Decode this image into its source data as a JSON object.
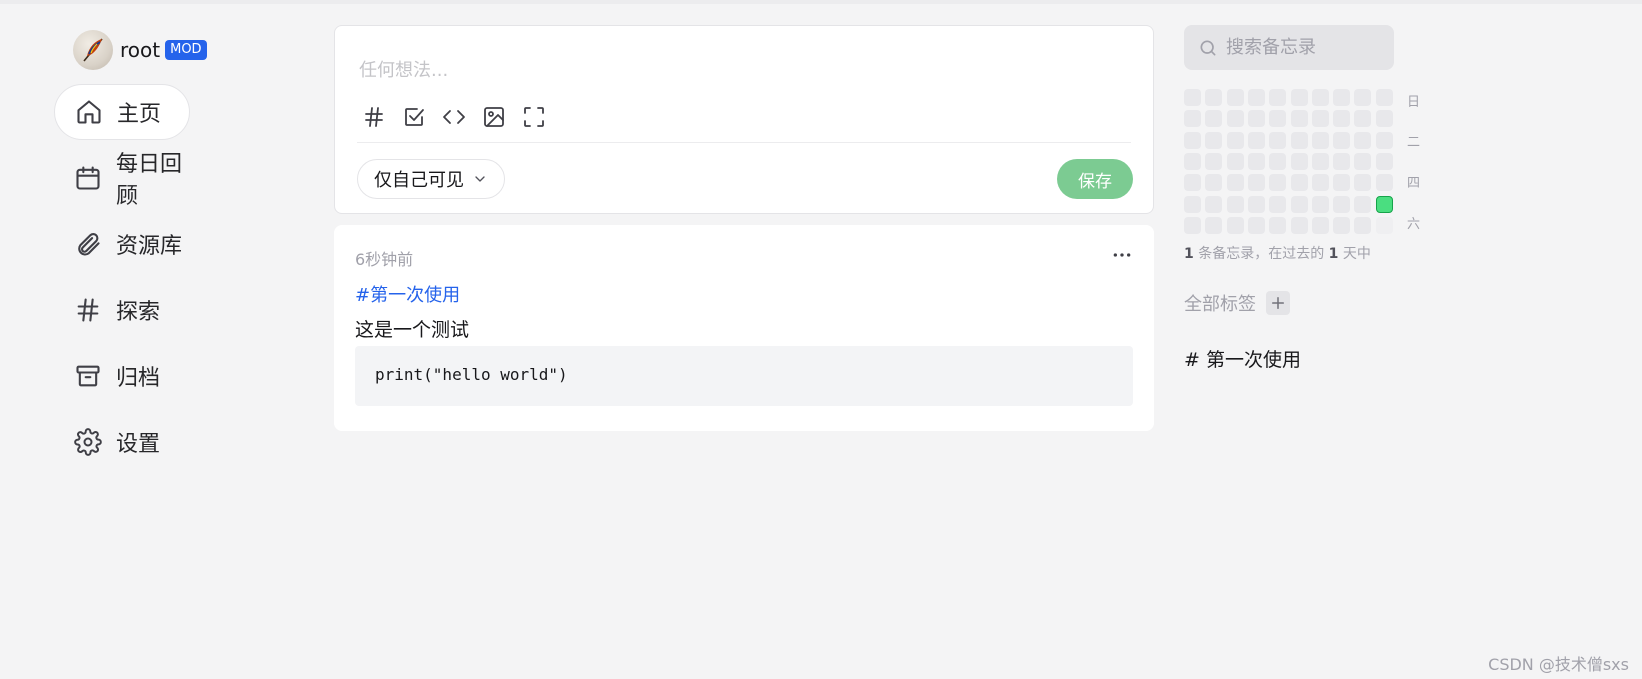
{
  "user": {
    "name": "root",
    "badge": "MOD"
  },
  "nav": [
    {
      "label": "主页",
      "icon": "home-icon",
      "active": true
    },
    {
      "label": "每日回顾",
      "icon": "calendar-icon"
    },
    {
      "label": "资源库",
      "icon": "paperclip-icon"
    },
    {
      "label": "探索",
      "icon": "hash-icon"
    },
    {
      "label": "归档",
      "icon": "archive-icon"
    },
    {
      "label": "设置",
      "icon": "gear-icon"
    }
  ],
  "editor": {
    "placeholder": "任何想法...",
    "toolbar": [
      "tag-icon",
      "checkbox-icon",
      "code-icon",
      "image-icon",
      "fullscreen-icon"
    ],
    "visibility": "仅自己可见",
    "save_label": "保存"
  },
  "memo": {
    "time": "6秒钟前",
    "tag": "#第一次使用",
    "text": "这是一个测试",
    "code": "print(\"hello world\")"
  },
  "search": {
    "placeholder": "搜索备忘录"
  },
  "heatmap": {
    "weekdays": [
      "日",
      "二",
      "四",
      "六"
    ],
    "summary_count": "1",
    "summary_text_a": " 条备忘录，在过去的 ",
    "summary_days": "1",
    "summary_text_b": " 天中"
  },
  "tags": {
    "title": "全部标签",
    "items": [
      "# 第一次使用"
    ]
  },
  "watermark": "CSDN @技术僧sxs",
  "colors": {
    "accent": "#2563eb",
    "save": "#7ccb92",
    "heat_active": "#4ade80"
  }
}
